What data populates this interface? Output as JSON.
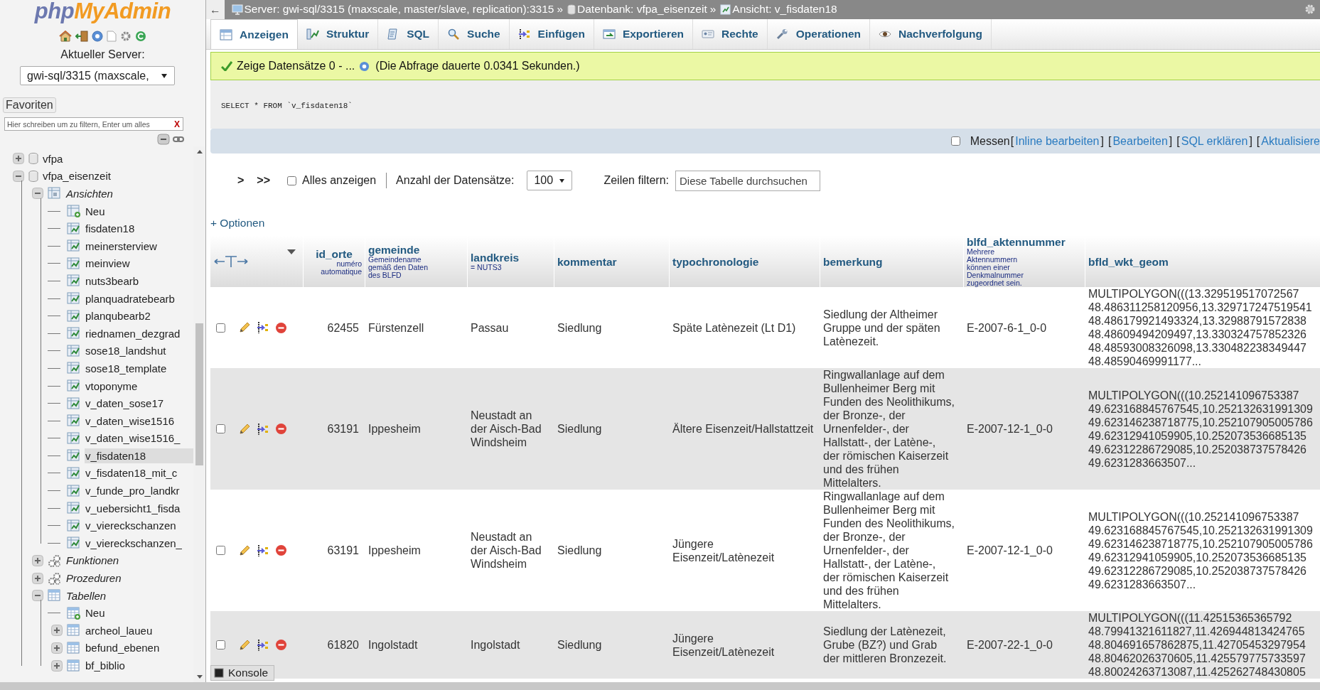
{
  "sidebar": {
    "logo": [
      "php",
      "MyAdmin"
    ],
    "server_label": "Aktueller Server:",
    "server_select": {
      "value": "gwi-sql/3315 (maxscale,"
    },
    "favorites": "Favoriten",
    "filter": {
      "placeholder": "Hier schreiben um zu filtern, Enter um alles",
      "clear": "X"
    },
    "tree": [
      {
        "label": "vfpa",
        "kind": "database",
        "expanded": false,
        "selected": false
      },
      {
        "label": "vfpa_eisenzeit",
        "kind": "database",
        "expanded": true,
        "selected": false,
        "children": [
          {
            "label": "Ansichten",
            "kind": "views",
            "expanded": true,
            "selected": false,
            "children": [
              {
                "label": "Neu",
                "kind": "new_view",
                "selected": false
              },
              {
                "label": "fisdaten18",
                "kind": "view",
                "selected": false
              },
              {
                "label": "meinersterview",
                "kind": "view",
                "selected": false
              },
              {
                "label": "meinview",
                "kind": "view",
                "selected": false
              },
              {
                "label": "nuts3bearb",
                "kind": "view",
                "selected": false
              },
              {
                "label": "planquadratebearb",
                "kind": "view",
                "selected": false
              },
              {
                "label": "planqubearb2",
                "kind": "view",
                "selected": false
              },
              {
                "label": "riednamen_dezgrad",
                "kind": "view",
                "selected": false
              },
              {
                "label": "sose18_landshut",
                "kind": "view",
                "selected": false
              },
              {
                "label": "sose18_template",
                "kind": "view",
                "selected": false
              },
              {
                "label": "vtoponyme",
                "kind": "view",
                "selected": false
              },
              {
                "label": "v_daten_sose17",
                "kind": "view",
                "selected": false
              },
              {
                "label": "v_daten_wise1516",
                "kind": "view",
                "selected": false
              },
              {
                "label": "v_daten_wise1516_",
                "kind": "view",
                "selected": false
              },
              {
                "label": "v_fisdaten18",
                "kind": "view",
                "selected": true
              },
              {
                "label": "v_fisdaten18_mit_c",
                "kind": "view",
                "selected": false
              },
              {
                "label": "v_funde_pro_landkr",
                "kind": "view",
                "selected": false
              },
              {
                "label": "v_uebersicht1_fisda",
                "kind": "view",
                "selected": false
              },
              {
                "label": "v_viereckschanzen",
                "kind": "view",
                "selected": false
              },
              {
                "label": "v_viereckschanzen_",
                "kind": "view",
                "selected": false
              }
            ]
          },
          {
            "label": "Funktionen",
            "kind": "functions",
            "expanded": false,
            "selected": false
          },
          {
            "label": "Prozeduren",
            "kind": "procedures",
            "expanded": false,
            "selected": false
          },
          {
            "label": "Tabellen",
            "kind": "tables",
            "expanded": true,
            "selected": false,
            "children": [
              {
                "label": "Neu",
                "kind": "new_table",
                "selected": false
              },
              {
                "label": "archeol_laueu",
                "kind": "table",
                "expanded": false,
                "selected": false
              },
              {
                "label": "befund_ebenen",
                "kind": "table",
                "expanded": false,
                "selected": false
              },
              {
                "label": "bf_biblio",
                "kind": "table",
                "expanded": false,
                "selected": false
              }
            ]
          }
        ]
      }
    ]
  },
  "breadcrumb": {
    "back": "←",
    "separator": "»",
    "items": [
      {
        "kind": "server",
        "label": "Server: gwi-sql/3315 (maxscale, master/slave, replication):3315"
      },
      {
        "kind": "database",
        "label": "Datenbank: vfpa_eisenzeit"
      },
      {
        "kind": "view",
        "label": "Ansicht: v_fisdaten18"
      }
    ]
  },
  "tabs": [
    {
      "label": "Anzeigen",
      "kind": "browse",
      "selected": true
    },
    {
      "label": "Struktur",
      "kind": "structure",
      "selected": false
    },
    {
      "label": "SQL",
      "kind": "sql",
      "selected": false
    },
    {
      "label": "Suche",
      "kind": "search",
      "selected": false
    },
    {
      "label": "Einfügen",
      "kind": "insert",
      "selected": false
    },
    {
      "label": "Exportieren",
      "kind": "export",
      "selected": false
    },
    {
      "label": "Rechte",
      "kind": "privileges",
      "selected": false
    },
    {
      "label": "Operationen",
      "kind": "operations",
      "selected": false
    },
    {
      "label": "Nachverfolgung",
      "kind": "tracking",
      "selected": false
    }
  ],
  "message": {
    "text": "Zeige Datensätze 0 - ...",
    "timing": "(Die Abfrage dauerte 0.0341 Sekunden.)"
  },
  "sql": "SELECT * FROM `v_fisdaten18`",
  "query_actions": {
    "profiling": {
      "label": "Messen",
      "checked": false
    },
    "links": [
      {
        "open": "[",
        "label": "Inline bearbeiten",
        "close": "]"
      },
      {
        "open": "[",
        "label": "Bearbeiten",
        "close": "]"
      },
      {
        "open": "[",
        "label": "SQL erklären",
        "close": "]"
      },
      {
        "open": "[",
        "label": "Aktualisiere"
      }
    ]
  },
  "navigation": {
    "next": ">",
    "last": ">>",
    "show_all": {
      "label": "Alles anzeigen",
      "checked": false
    },
    "rows_label": "Anzahl der Datensätze:",
    "rows_value": "100",
    "filter_label": "Zeilen filtern:",
    "filter_placeholder": "Diese Tabelle durchsuchen"
  },
  "options": "+ Optionen",
  "table": {
    "columns": [
      {
        "name": "id_orte",
        "comment": "numéro automatique"
      },
      {
        "name": "gemeinde",
        "comment": "Gemeindename gemäß den Daten des BLFD"
      },
      {
        "name": "landkreis",
        "comment": "= NUTS3"
      },
      {
        "name": "kommentar"
      },
      {
        "name": "typochronologie"
      },
      {
        "name": "bemerkung"
      },
      {
        "name": "blfd_aktennummer",
        "comment": "Mehrere Aktennummern können einer Denkmalnummer zugeordnet sein."
      },
      {
        "name": "bfld_wkt_geom"
      }
    ],
    "rows": [
      {
        "checked": false,
        "cells": [
          "62455",
          "Fürstenzell",
          "Passau",
          "Siedlung",
          "Späte Latènezeit (Lt D1)",
          "Siedlung der Altheimer\nGruppe und der späten\nLatènezeit.",
          "E-2007-6-1_0-0",
          "MULTIPOLYGON(((13.329519517072567\n48.486311258120956,13.329717247519541\n48.486179921493324,13.32988791572838\n48.48609494209497,13.330324757852326\n48.48593008326098,13.330482238349447\n48.48590469991177..."
        ]
      },
      {
        "checked": false,
        "cells": [
          "63191",
          "Ippesheim",
          "Neustadt an der Aisch-Bad Windsheim",
          "Siedlung",
          "Ältere Eisenzeit/Hallstattzeit",
          "Ringwallanlage auf dem\nBullenheimer Berg mit\nFunden des Neolithikums,\nder Bronze-, der\nUrnenfelder-, der\nHallstatt-, der Latène-,\nder römischen Kaiserzeit\nund des frühen\nMittelalters.",
          "E-2007-12-1_0-0",
          "MULTIPOLYGON(((10.252141096753387\n49.623168845767545,10.252132631991309\n49.623146238718775,10.252107905005786\n49.62312941059905,10.252073536685135\n49.62312286729085,10.252038737578426\n49.6231283663507..."
        ]
      },
      {
        "checked": false,
        "cells": [
          "63191",
          "Ippesheim",
          "Neustadt an der Aisch-Bad Windsheim",
          "Siedlung",
          "Jüngere Eisenzeit/Latènezeit",
          "Ringwallanlage auf dem\nBullenheimer Berg mit\nFunden des Neolithikums,\nder Bronze-, der\nUrnenfelder-, der\nHallstatt-, der Latène-,\nder römischen Kaiserzeit\nund des frühen\nMittelalters.",
          "E-2007-12-1_0-0",
          "MULTIPOLYGON(((10.252141096753387\n49.623168845767545,10.252132631991309\n49.623146238718775,10.252107905005786\n49.62312941059905,10.252073536685135\n49.62312286729085,10.252038737578426\n49.6231283663507..."
        ]
      },
      {
        "checked": false,
        "cells": [
          "61820",
          "Ingolstadt",
          "Ingolstadt",
          "Siedlung",
          "Jüngere Eisenzeit/Latènezeit",
          "Siedlung der Latènezeit,\nGrube (BZ?) und Grab\nder mittleren Bronzezeit.",
          "E-2007-22-1_0-0",
          "MULTIPOLYGON(((11.42515365365792\n48.79941321611827,11.426944813424765\n48.804691657862875,11.42705453297954\n48.80462026370605,11.425579775733597\n48.80024263713087,11.425262748430805"
        ]
      }
    ]
  },
  "console": "Konsole"
}
